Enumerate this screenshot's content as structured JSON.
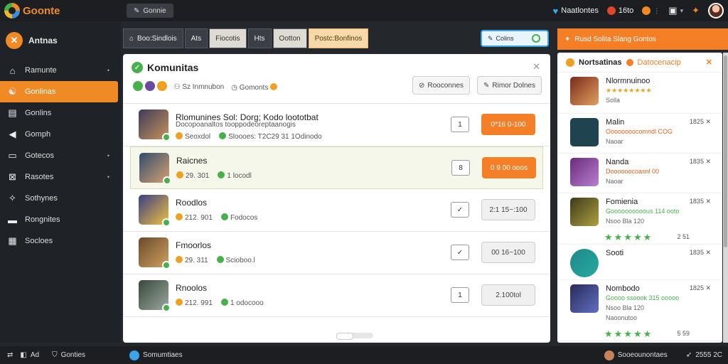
{
  "app": {
    "title": "Goonte",
    "top_button": "Gonnie"
  },
  "top_right": {
    "user": "Naatlontes",
    "score": "16to"
  },
  "sidebar": {
    "header": "Antnas",
    "items": [
      {
        "label": "Ramunte",
        "icon": "home-icon",
        "chev": "•"
      },
      {
        "label": "Gonlinas",
        "icon": "gamepad-icon",
        "active": true
      },
      {
        "label": "Gonlins",
        "icon": "grid-icon"
      },
      {
        "label": "Gomph",
        "icon": "megaphone-icon"
      },
      {
        "label": "Gotecos",
        "icon": "folder-icon",
        "chev": "•"
      },
      {
        "label": "Rasotes",
        "icon": "tag-icon",
        "chev": "•"
      },
      {
        "label": "Sothynes",
        "icon": "wrench-icon"
      },
      {
        "label": "Rongnites",
        "icon": "chart-icon"
      },
      {
        "label": "Socloes",
        "icon": "table-icon"
      }
    ]
  },
  "tabs": [
    {
      "label": "Boo:Sindlois",
      "style": "dark"
    },
    {
      "label": "Ats",
      "style": "dark"
    },
    {
      "label": "Fiocotis",
      "style": "light"
    },
    {
      "label": "Hts",
      "style": "dark"
    },
    {
      "label": "Ootton",
      "style": "light"
    },
    {
      "label": "Postc:Bonfinos",
      "style": "orange"
    }
  ],
  "search": {
    "label": "Colins"
  },
  "main": {
    "title": "Komunitas",
    "meta_left": "Sz Inmnubon",
    "meta_right": "Gomonts",
    "btn_left": "Rooconnes",
    "btn_right": "Rimor Dolnes",
    "rows": [
      {
        "title": "Rlomunines Sol: Dorg; Kodo loototbat",
        "sub1": "Docopoanaltos tooppodeoreptaanogis",
        "sub2a": "Seoxdol",
        "sub2b": "Sloooes: T2C29 31 1Odinodo",
        "count": "1",
        "action": "0*16 0-100",
        "action_style": "or",
        "colors": [
          "#3d3b5a",
          "#c8925a"
        ]
      },
      {
        "title": "Raicnes",
        "sub1": "",
        "sub2a": "29. 301",
        "sub2b": "1 locodl",
        "count": "8",
        "action": "0 9 00 ooos",
        "action_style": "or",
        "selected": true,
        "colors": [
          "#2e4d6e",
          "#d8a070"
        ]
      },
      {
        "title": "Roodlos",
        "sub1": "",
        "sub2a": "212. 901",
        "sub2b": "Fodocos",
        "count": "✓",
        "action": "2:1 15~:100",
        "action_style": "gr",
        "colors": [
          "#3a3f86",
          "#f0c040"
        ]
      },
      {
        "title": "Fmoorlos",
        "sub1": "",
        "sub2a": "29. 311",
        "sub2b": "Scioboo.l",
        "count": "✓",
        "action": "00 16~100",
        "action_style": "gr",
        "colors": [
          "#6a4a2a",
          "#d0a060"
        ]
      },
      {
        "title": "Rnoolos",
        "sub1": "",
        "sub2a": "212. 991",
        "sub2b": "1 odocooo",
        "count": "1",
        "action": "2.100tol",
        "action_style": "gr",
        "colors": [
          "#39483a",
          "#9aa8a0"
        ]
      }
    ]
  },
  "right_panel": {
    "header": "Rusd Solita Slang Gontos",
    "title": "Nortsatinas",
    "title_sub": "Datocenacip",
    "items": [
      {
        "name": "Nlormnuinoo",
        "line1": "★★★★★★★★",
        "line2": "Solla",
        "meta": "",
        "colors": [
          "#7a2a1a",
          "#e0a060"
        ]
      },
      {
        "name": "Malin",
        "line1": "Oooooooocomndl COG",
        "line2": "Naoar",
        "meta": "1825",
        "colors": [
          "#1f4450",
          "#1f4450"
        ]
      },
      {
        "name": "Nanda",
        "line1": "Doooooocoasnl 00",
        "line2": "Naoar",
        "meta": "1835",
        "colors": [
          "#6a2a7a",
          "#b880d0"
        ]
      },
      {
        "name": "Fomienia",
        "line1": "Goooooooooous 114 ooto",
        "line2": "Nsoo Bla 120",
        "meta": "1835",
        "stars_text": "2 51",
        "colors": [
          "#3a3a1a",
          "#b0a040"
        ]
      },
      {
        "name": "Sooti",
        "line1": "",
        "line2": "",
        "meta": "1835",
        "colors": [
          "#1c8a8a",
          "#2aa8a0"
        ]
      },
      {
        "name": "Nombodo",
        "line1": "Goooo ssoook 315 ooooo",
        "line2": "Nsoo Bla 120",
        "line3": "Naoonutoo",
        "meta": "1825",
        "stars_text": "5 59",
        "colors": [
          "#2a2a5a",
          "#6070c0"
        ]
      }
    ]
  },
  "bottom": {
    "left1": "Ad",
    "left2": "Gonties",
    "center": "Somumtiaes",
    "right1": "Sooeounontaes",
    "right2": "2555 2C"
  },
  "colors": {
    "accent": "#f57f26",
    "green": "#46b04a",
    "blue": "#3aa6e8"
  }
}
